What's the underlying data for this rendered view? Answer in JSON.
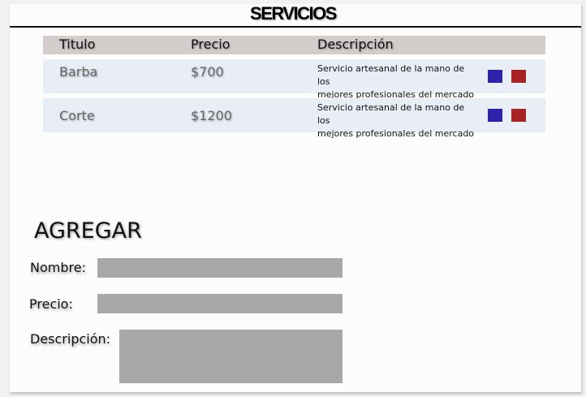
{
  "header": {
    "title": "SERVICIOS"
  },
  "table": {
    "columns": [
      "Titulo",
      "Precio",
      "Descripción"
    ],
    "rows": [
      {
        "titulo": "Barba",
        "precio": "$700",
        "descripcion_line1": "Servicio artesanal de la mano de los",
        "descripcion_line2": "mejores profesionales del mercado"
      },
      {
        "titulo": "Corte",
        "precio": "$1200",
        "descripcion_line1": "Servicio artesanal de la mano de los",
        "descripcion_line2": "mejores profesionales del mercado"
      }
    ],
    "action_colors": {
      "edit": "#2e22aa",
      "delete": "#a82424"
    }
  },
  "form": {
    "title": "AGREGAR",
    "nombre_label": "Nombre:",
    "precio_label": "Precio:",
    "descripcion_label": "Descripción:",
    "nombre_value": "",
    "precio_value": "",
    "descripcion_value": ""
  }
}
